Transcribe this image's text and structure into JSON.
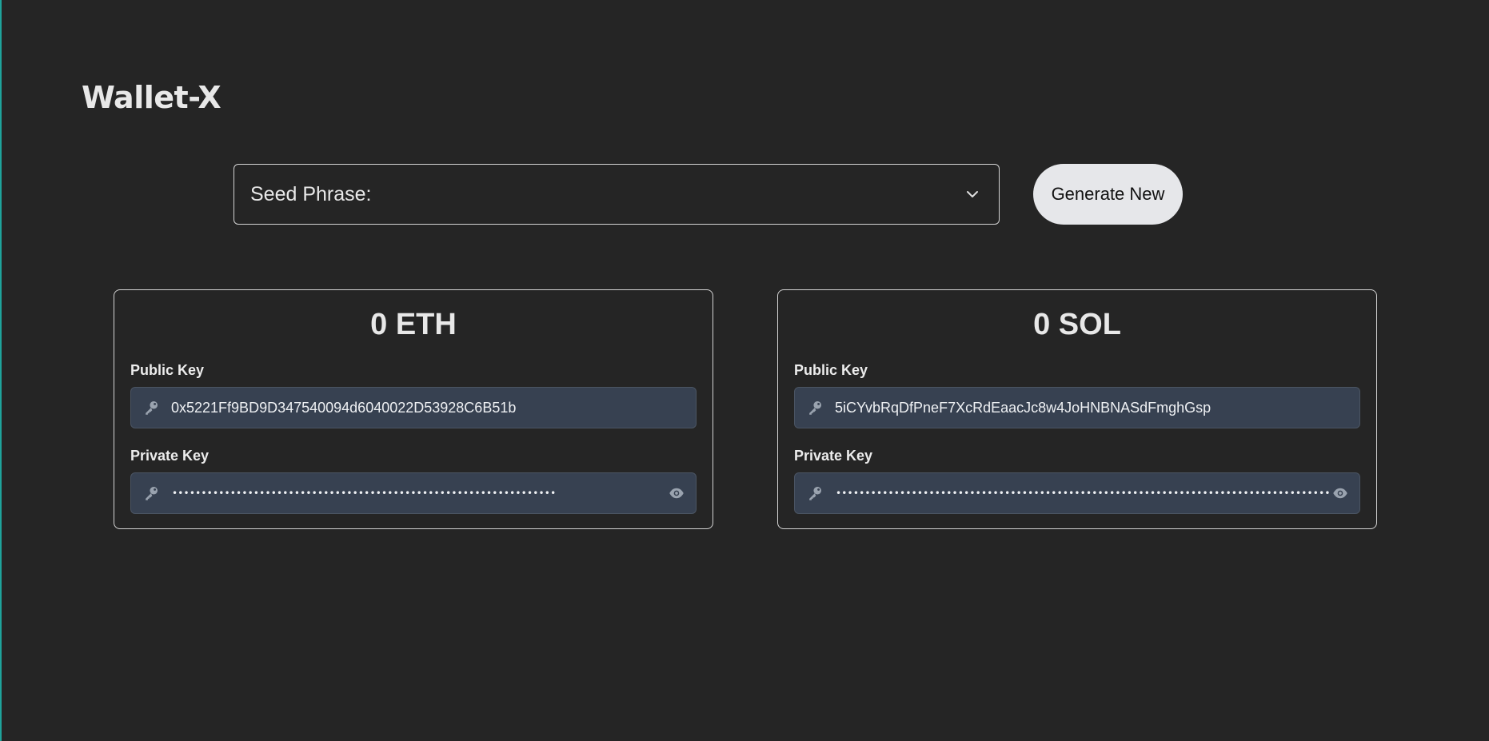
{
  "app": {
    "title": "Wallet-X"
  },
  "seed": {
    "label": "Seed Phrase:",
    "generate_label": "Generate New"
  },
  "wallets": {
    "eth": {
      "balance": "0 ETH",
      "public_label": "Public Key",
      "public_key": "0x5221Ff9BD9D347540094d6040022D53928C6B51b",
      "private_label": "Private Key",
      "private_masked": "••••••••••••••••••••••••••••••••••••••••••••••••••••••••••••••••••"
    },
    "sol": {
      "balance": "0 SOL",
      "public_label": "Public Key",
      "public_key": "5iCYvbRqDfPneF7XcRdEaacJc8w4JoHNBNASdFmghGsp",
      "private_label": "Private Key",
      "private_masked": "••••••••••••••••••••••••••••••••••••••••••••••••••••••••••••••••••••••••••••••••••••••••••••"
    }
  },
  "icons": {
    "key": "key-icon",
    "eye": "eye-icon",
    "chevron": "chevron-down-icon"
  },
  "colors": {
    "background": "#252525",
    "field_bg": "#374151",
    "button_bg": "#e6e7ea",
    "accent_edge": "#1fa39b"
  }
}
